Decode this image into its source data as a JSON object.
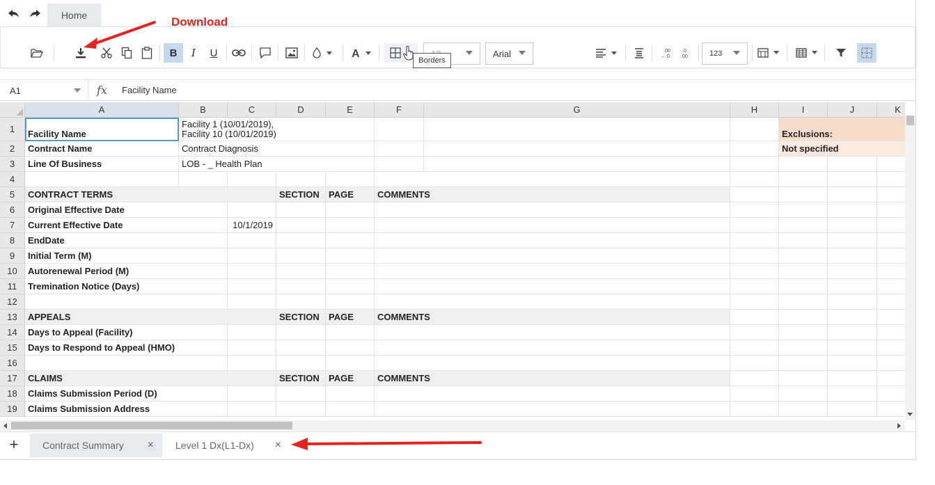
{
  "app": {
    "home_tab": "Home"
  },
  "annotations": {
    "download_label": "Download",
    "arrow_color": "#e5221c"
  },
  "toolbar": {
    "font_size": "13",
    "font_family": "Arial",
    "number_format": "123",
    "tooltip": "Borders"
  },
  "formula_bar": {
    "cell_ref": "A1",
    "fx_label": "fx",
    "value": "Facility Name"
  },
  "columns": [
    "A",
    "B",
    "C",
    "D",
    "E",
    "F",
    "G",
    "H",
    "I",
    "J",
    "K"
  ],
  "rows": [
    "1",
    "2",
    "3",
    "4",
    "5",
    "6",
    "7",
    "8",
    "9",
    "10",
    "11",
    "12",
    "13",
    "14",
    "15",
    "16",
    "17",
    "18",
    "19"
  ],
  "cells": {
    "r1_a": "Facility Name",
    "r1_b_line1": "Facility 1 (10/01/2019),",
    "r1_b_line2": "Facility 10 (10/01/2019)",
    "r1_i": "Exclusions:",
    "r2_a": "Contract Name",
    "r2_b": "Contract Diagnosis",
    "r2_i": "Not specified",
    "r3_a": "Line Of Business",
    "r3_b": "LOB - _ Health Plan",
    "r5_a": "CONTRACT TERMS",
    "r5_d": "SECTION",
    "r5_e": "PAGE",
    "r5_f": "COMMENTS",
    "r6_a": "Original Effective Date",
    "r7_a": "Current Effective Date",
    "r7_c": "10/1/2019",
    "r8_a": "EndDate",
    "r9_a": "Initial Term (M)",
    "r10_a": "Autorenewal Period (M)",
    "r11_a": "Tremination Notice (Days)",
    "r13_a": "APPEALS",
    "r13_d": "SECTION",
    "r13_e": "PAGE",
    "r13_f": "COMMENTS",
    "r14_a": "Days to Appeal (Facility)",
    "r15_a": "Days to Respond to Appeal (HMO)",
    "r17_a": "CLAIMS",
    "r17_d": "SECTION",
    "r17_e": "PAGE",
    "r17_f": "COMMENTS",
    "r18_a": "Claims Submission Period (D)",
    "r19_a": "Claims Submission Address"
  },
  "sheet_tabs": [
    {
      "label": "Contract Summary",
      "close": "×"
    },
    {
      "label": "Level 1 Dx(L1-Dx)",
      "close": "×"
    }
  ],
  "add_sheet": "+"
}
